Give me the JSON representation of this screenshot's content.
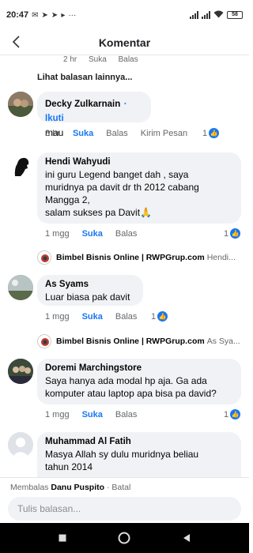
{
  "status": {
    "time": "20:47",
    "battery": "58"
  },
  "header": {
    "title": "Komentar"
  },
  "partial": {
    "time": "2 hr",
    "like": "Suka",
    "reply": "Balas"
  },
  "more_replies": "Lihat balasan lainnya...",
  "comments": [
    {
      "name": "Decky Zulkarnain",
      "follow": "Ikuti",
      "text": [
        "mau"
      ],
      "time": "3 hr",
      "like": "Suka",
      "reply": "Balas",
      "extra": "Kirim Pesan",
      "likes": "1"
    },
    {
      "name": "Hendi Wahyudi",
      "text": [
        "ini guru Legend banget dah , saya",
        "muridnya pa davit dr th 2012 cabang",
        "Mangga 2,",
        "salam sukses pa Davit🙏"
      ],
      "time": "1 mgg",
      "like": "Suka",
      "reply": "Balas",
      "likes": "1",
      "page_reply": {
        "name": "Bimbel Bisnis Online | RWPGrup.com",
        "extra": "Hendi..."
      }
    },
    {
      "name": "As Syams",
      "text": [
        "Luar biasa pak davit"
      ],
      "time": "1 mgg",
      "like": "Suka",
      "reply": "Balas",
      "likes": "1",
      "page_reply": {
        "name": "Bimbel Bisnis Online | RWPGrup.com",
        "extra": "As Sya..."
      }
    },
    {
      "name": "Doremi Marchingstore",
      "text": [
        "Saya hanya ada modal hp aja. Ga ada",
        "komputer atau laptop apa bisa pa david?"
      ],
      "time": "1 mgg",
      "like": "Suka",
      "reply": "Balas",
      "likes": "1"
    },
    {
      "name": "Muhammad Al Fatih",
      "text": [
        "Masya Allah sy dulu muridnya beliau",
        "tahun 2014"
      ]
    }
  ],
  "reply_bar": {
    "prefix": "Membalas",
    "target": "Danu Puspito",
    "cancel": "· Batal",
    "placeholder": "Tulis balasan..."
  },
  "colors": {
    "accent": "#1877f2",
    "bubble": "#f0f2f5",
    "muted": "#65676b"
  }
}
